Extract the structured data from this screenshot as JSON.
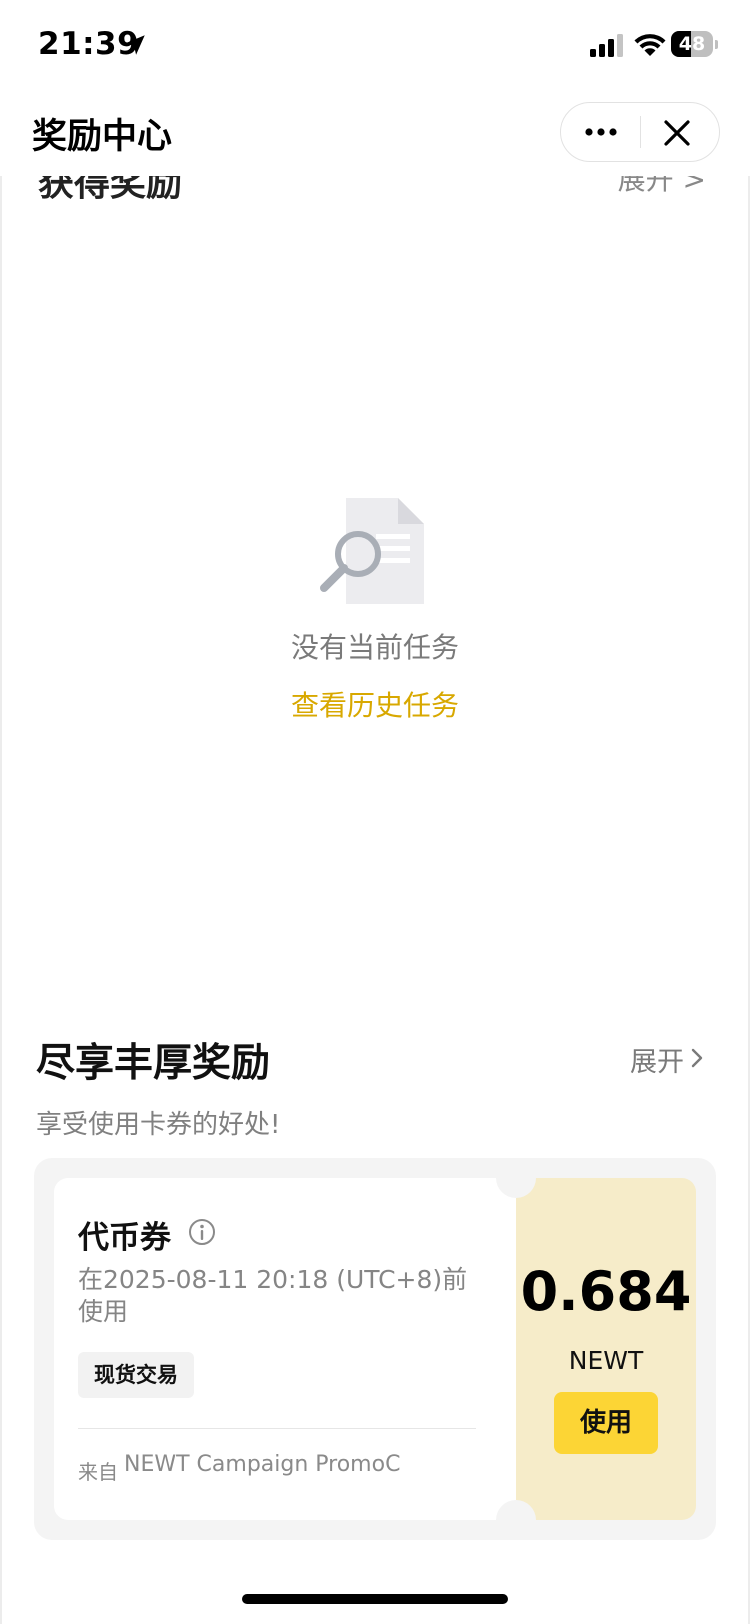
{
  "status_bar": {
    "time": "21:39",
    "battery_percent": 48,
    "battery_label": "48"
  },
  "header": {
    "title": "奖励中心"
  },
  "earned_section": {
    "title": "获得奖励",
    "expand_label": "展开 >",
    "empty_text": "没有当前任务",
    "history_link": "查看历史任务"
  },
  "rewards_section": {
    "title": "尽享丰厚奖励",
    "expand_label": "展开",
    "description": "享受使用卡券的好处!"
  },
  "coupon": {
    "type": "代币券",
    "expiry": "在2025-08-11 20:18 (UTC+8)前使用",
    "tag": "现货交易",
    "source_prefix": "来自",
    "source_name": "NEWT Campaign PromoC",
    "amount": "0.684",
    "unit": "NEWT",
    "use_label": "使用"
  },
  "colors": {
    "accent": "#fcd535",
    "link": "#d8a800",
    "coupon_right_bg": "#f6ecc9"
  },
  "icons": [
    "location-arrow-icon",
    "signal-icon",
    "wifi-icon",
    "battery-icon",
    "more-dots-icon",
    "close-icon",
    "empty-document-search-icon",
    "chevron-right-icon",
    "info-icon"
  ]
}
